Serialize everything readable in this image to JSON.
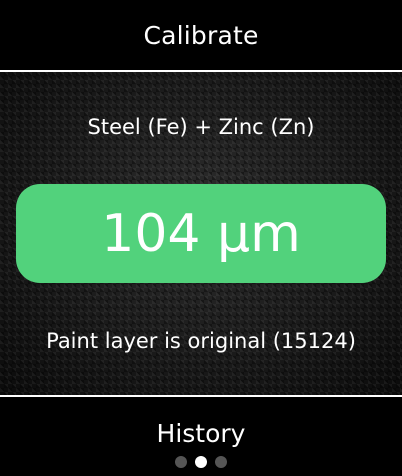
{
  "header": {
    "calibrate_label": "Calibrate"
  },
  "measurement": {
    "material": "Steel (Fe) + Zinc (Zn)",
    "value": "104 µm",
    "status": "Paint layer is original (15124)",
    "status_color": "#52d27c"
  },
  "footer": {
    "history_label": "History"
  },
  "pagination": {
    "total_pages": 3,
    "active_page": 2
  }
}
